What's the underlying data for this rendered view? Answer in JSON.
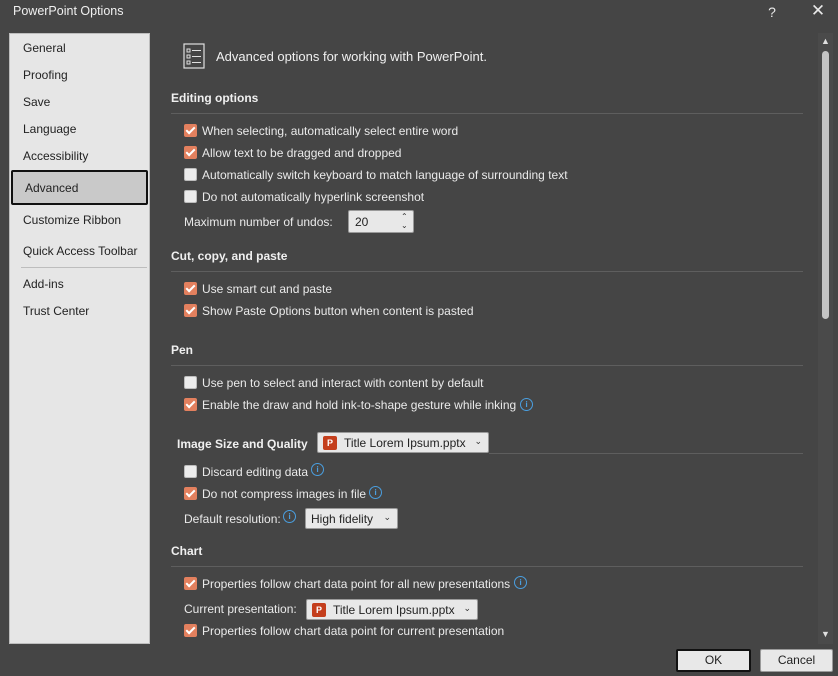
{
  "window": {
    "title": "PowerPoint Options",
    "help": "?",
    "close": "✕"
  },
  "sidebar": {
    "items": [
      {
        "label": "General"
      },
      {
        "label": "Proofing"
      },
      {
        "label": "Save"
      },
      {
        "label": "Language"
      },
      {
        "label": "Accessibility"
      },
      {
        "label": "Advanced",
        "selected": true
      },
      {
        "label": "Customize Ribbon"
      },
      {
        "label": "Quick Access Toolbar"
      },
      {
        "label": "Add-ins"
      },
      {
        "label": "Trust Center"
      }
    ]
  },
  "header": {
    "text": "Advanced options for working with PowerPoint.",
    "icon": "advanced-options-icon"
  },
  "editing": {
    "title": "Editing options",
    "options": [
      {
        "label": "When selecting, automatically select entire word",
        "checked": true
      },
      {
        "label": "Allow text to be dragged and dropped",
        "checked": true
      },
      {
        "label": "Automatically switch keyboard to match language of surrounding text",
        "checked": false
      },
      {
        "label": "Do not automatically hyperlink screenshot",
        "checked": false
      }
    ],
    "undos_label": "Maximum number of undos:",
    "undos_value": "20"
  },
  "cutcopy": {
    "title": "Cut, copy, and paste",
    "options": [
      {
        "label": "Use smart cut and paste",
        "checked": true
      },
      {
        "label": "Show Paste Options button when content is pasted",
        "checked": true
      }
    ]
  },
  "pen": {
    "title": "Pen",
    "options": [
      {
        "label": "Use pen to select and interact with content by default",
        "checked": false
      },
      {
        "label": "Enable the draw and hold ink-to-shape gesture while inking",
        "checked": true
      }
    ]
  },
  "image": {
    "title": "Image Size and Quality",
    "file": "Title Lorem Ipsum.pptx",
    "options": [
      {
        "label": "Discard editing data",
        "checked": false
      },
      {
        "label": "Do not compress images in file",
        "checked": true
      }
    ],
    "resolution_label": "Default resolution:",
    "resolution_value": "High fidelity"
  },
  "chart": {
    "title": "Chart",
    "options": [
      {
        "label": "Properties follow chart data point for all new presentations",
        "checked": true
      },
      {
        "label": "Properties follow chart data point for current presentation",
        "checked": true
      }
    ],
    "current_label": "Current presentation:",
    "current_file": "Title Lorem Ipsum.pptx"
  },
  "info_glyph": "i",
  "ppt_glyph": "P",
  "chevron": "⌄",
  "buttons": {
    "ok": "OK",
    "cancel": "Cancel"
  },
  "colors": {
    "accent": "#e3805e",
    "info": "#4a9fe0",
    "background": "#454545"
  }
}
